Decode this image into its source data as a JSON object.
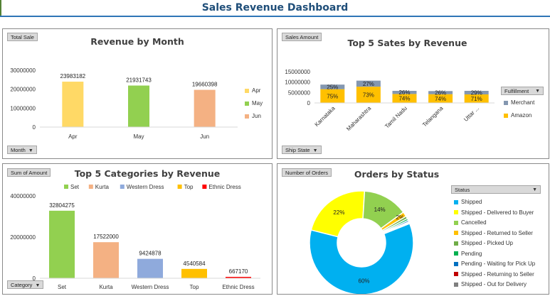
{
  "dashboard": {
    "title": "Sales Revenue Dashboard"
  },
  "colors": {
    "apr": "#ffd966",
    "may": "#92d050",
    "jun": "#f4b183",
    "merchant": "#8497b0",
    "amazon": "#ffc000",
    "set": "#92d050",
    "kurta": "#f4b183",
    "western": "#8faadc",
    "top": "#ffc000",
    "ethnic": "#ff0000",
    "shipped": "#00b0f0",
    "delivered": "#ffff00",
    "cancelled": "#92d050",
    "returned": "#ffc000",
    "pickedup": "#70ad47",
    "pending": "#00b050",
    "waiting": "#0070c0",
    "returning": "#c00000",
    "outdelivery": "#7f7f7f"
  },
  "panel1": {
    "field_button": "Total Sale",
    "axis_button": "Month",
    "chart_data": {
      "type": "bar",
      "title": "Revenue by Month",
      "categories": [
        "Apr",
        "May",
        "Jun"
      ],
      "values": [
        23983182,
        21931743,
        19660398
      ],
      "value_labels": [
        "23983182",
        "21931743",
        "19660398"
      ],
      "ylim": [
        0,
        30000000
      ],
      "yticks": [
        0,
        10000000,
        20000000,
        30000000
      ],
      "ytick_labels": [
        "0",
        "10000000",
        "20000000",
        "30000000"
      ],
      "legend": [
        "Apr",
        "May",
        "Jun"
      ],
      "legend_position": "right",
      "colors": [
        "#ffd966",
        "#92d050",
        "#f4b183"
      ],
      "grid": false
    }
  },
  "panel2": {
    "field_button": "Sales Amount",
    "axis_button": "Ship State",
    "legend_title": "Fulfillment",
    "chart_data": {
      "type": "bar",
      "stacked": true,
      "title": "Top 5 Sates by Revenue",
      "categories": [
        "Karnataka",
        "Maharashtra",
        "Tamil Nadu",
        "Telangana",
        "Uttar ..."
      ],
      "series": [
        {
          "name": "Amazon",
          "values": [
            6600000,
            7800000,
            4300000,
            4200000,
            4100000
          ],
          "labels": [
            "75%",
            "73%",
            "74%",
            "74%",
            "71%"
          ]
        },
        {
          "name": "Merchant",
          "values": [
            2200000,
            2900000,
            1500000,
            1500000,
            1700000
          ],
          "labels": [
            "25%",
            "27%",
            "26%",
            "26%",
            "29%"
          ]
        }
      ],
      "legend": [
        "Merchant",
        "Amazon"
      ],
      "legend_position": "right",
      "ylim": [
        0,
        15000000
      ],
      "yticks": [
        0,
        5000000,
        10000000,
        15000000
      ],
      "ytick_labels": [
        "0",
        "5000000",
        "10000000",
        "15000000"
      ],
      "grid": false
    }
  },
  "panel3": {
    "field_button": "Sum of Amount",
    "axis_button": "Category",
    "chart_data": {
      "type": "bar",
      "title": "Top 5 Categories by Revenue",
      "categories": [
        "Set",
        "Kurta",
        "Western Dress",
        "Top",
        "Ethnic Dress"
      ],
      "values": [
        32804275,
        17522000,
        9424878,
        4540584,
        667170
      ],
      "value_labels": [
        "32804275",
        "17522000",
        "9424878",
        "4540584",
        "667170"
      ],
      "legend": [
        "Set",
        "Kurta",
        "Western Dress",
        "Top",
        "Ethnic Dress"
      ],
      "legend_position": "top",
      "ylim": [
        0,
        40000000
      ],
      "yticks": [
        0,
        20000000,
        40000000
      ],
      "ytick_labels": [
        "0",
        "20000000",
        "40000000"
      ],
      "grid": false
    }
  },
  "panel4": {
    "field_button": "Number of Orders",
    "legend_title": "Status",
    "chart_data": {
      "type": "pie",
      "donut": true,
      "title": "Orders by Status",
      "slices": [
        {
          "label": "Shipped",
          "value": 60,
          "display": "60%"
        },
        {
          "label": "Shipped - Delivered to Buyer",
          "value": 22,
          "display": "22%"
        },
        {
          "label": "Cancelled",
          "value": 14,
          "display": "14%"
        },
        {
          "label": "Shipped - Returned to Seller",
          "value": 1.5,
          "display": "2%"
        },
        {
          "label": "Shipped - Picked Up",
          "value": 0.8,
          "display": ""
        },
        {
          "label": "Pending",
          "value": 0.6,
          "display": ""
        },
        {
          "label": "Pending - Waiting for Pick Up",
          "value": 0.5,
          "display": ""
        },
        {
          "label": "Shipped - Returning to Seller",
          "value": 0.3,
          "display": ""
        },
        {
          "label": "Shipped - Out for Delivery",
          "value": 0.3,
          "display": ""
        }
      ],
      "legend_position": "right"
    }
  }
}
